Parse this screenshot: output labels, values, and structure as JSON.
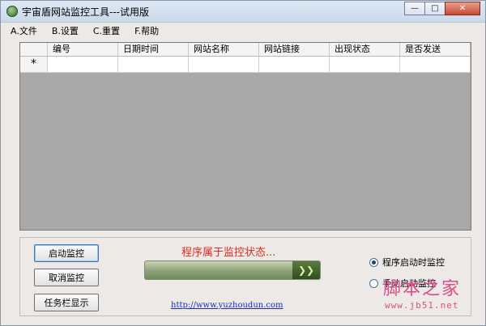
{
  "window": {
    "title": "宇宙盾网站监控工具---试用版",
    "controls": {
      "minimize": "—",
      "maximize": "□",
      "close": "✕"
    }
  },
  "menu": [
    "A.文件",
    "B.设置",
    "C.重置",
    "F.帮助"
  ],
  "grid": {
    "columns": [
      "编号",
      "日期时间",
      "网站名称",
      "网站链接",
      "出现状态",
      "是否发送"
    ],
    "new_row_marker": "*"
  },
  "panel": {
    "buttons": {
      "start": "启动监控",
      "cancel": "取消监控",
      "taskbar": "任务栏显示"
    },
    "status_text": "程序属于监控状态...",
    "progress_head": "❯❯",
    "link": "http://www.yuzhoudun.com",
    "radios": [
      {
        "label": "程序启动时监控",
        "selected": true
      },
      {
        "label": "手动启动监控",
        "selected": false
      }
    ]
  },
  "watermark": {
    "main": "脚本之家",
    "url": "www.jb51.net"
  },
  "colors": {
    "status_red": "#e02b1f",
    "link_blue": "#1a2bbf",
    "watermark_pink": "#e14a8a"
  }
}
